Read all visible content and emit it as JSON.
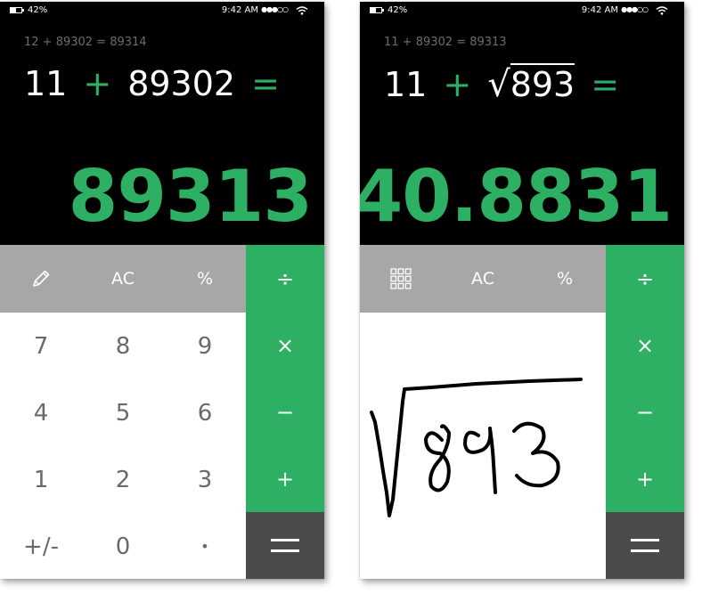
{
  "left": {
    "status": {
      "battery": "42%",
      "time": "9:42 AM",
      "signal": "●●●○○"
    },
    "display": {
      "history": "12 + 89302 = 89314",
      "expr_a": "11",
      "expr_op": "+",
      "expr_b": "89302",
      "expr_eq": "=",
      "result": "89313"
    },
    "top_keys": [
      "AC",
      "%"
    ],
    "operators": {
      "divide": "÷",
      "multiply": "×",
      "minus": "−",
      "plus": "+"
    },
    "digits": [
      "7",
      "8",
      "9",
      "4",
      "5",
      "6",
      "1",
      "2",
      "3",
      "+/-",
      "0",
      "•"
    ]
  },
  "right": {
    "status": {
      "battery": "42%",
      "time": "9:42 AM",
      "signal": "●●●○○"
    },
    "display": {
      "history": "11 + 89302 = 89313",
      "expr_a": "11",
      "expr_op": "+",
      "expr_sqrt": "√",
      "expr_b": "893",
      "expr_eq": "=",
      "result": "40.8831"
    },
    "top_keys": [
      "AC",
      "%"
    ],
    "operators": {
      "divide": "÷",
      "multiply": "×",
      "minus": "−",
      "plus": "+"
    },
    "handwriting": "√893"
  },
  "colors": {
    "accent": "#2eb064",
    "display_bg": "#000000",
    "top_keys_bg": "#a7a7a7",
    "equals_bg": "#4b4b4b",
    "digit_text": "#6a6a6a"
  },
  "icons": {
    "left_top_key": "pencil-icon",
    "right_top_key": "grid-keypad-icon",
    "status_battery": "battery-icon",
    "status_wifi": "wifi-icon"
  }
}
